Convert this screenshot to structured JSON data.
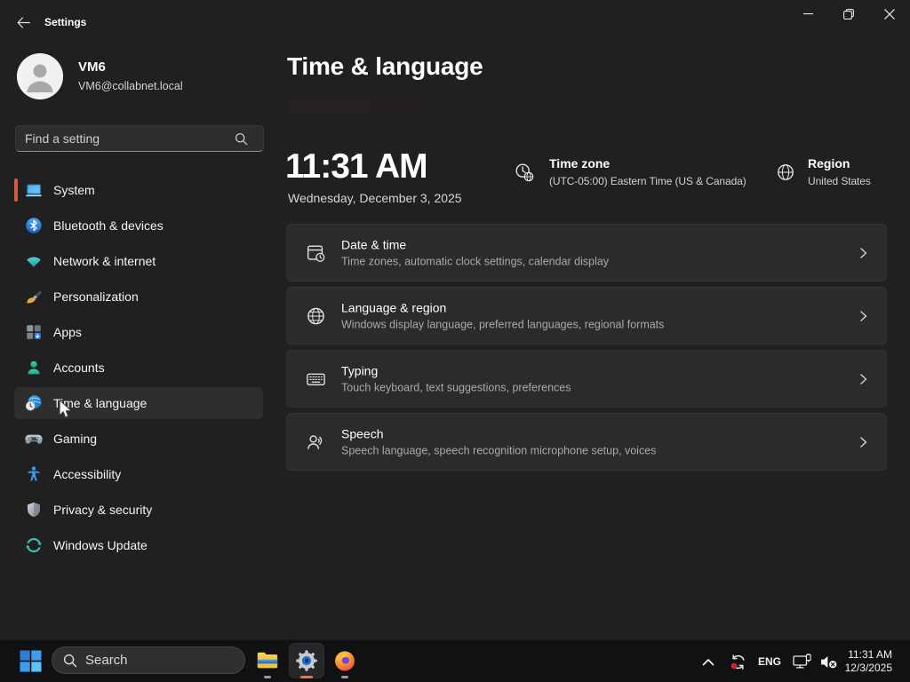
{
  "colors": {
    "accent": "#d25b41",
    "background": "#202020",
    "card": "#2b2b2b",
    "taskbar": "#101113"
  },
  "titlebar": {
    "app_title": "Settings",
    "back_icon": "back-arrow",
    "controls": [
      "minimize",
      "restore",
      "close"
    ]
  },
  "user": {
    "name": "VM6",
    "email": "VM6@collabnet.local"
  },
  "sidebar": {
    "search_placeholder": "Find a setting",
    "selected_item": "Time & language",
    "accent_pill_at": "System",
    "items": [
      {
        "label": "System",
        "icon": "system-icon"
      },
      {
        "label": "Bluetooth & devices",
        "icon": "bluetooth-icon"
      },
      {
        "label": "Network & internet",
        "icon": "network-icon"
      },
      {
        "label": "Personalization",
        "icon": "personalization-icon"
      },
      {
        "label": "Apps",
        "icon": "apps-icon"
      },
      {
        "label": "Accounts",
        "icon": "accounts-icon"
      },
      {
        "label": "Time & language",
        "icon": "time-language-icon"
      },
      {
        "label": "Gaming",
        "icon": "gaming-icon"
      },
      {
        "label": "Accessibility",
        "icon": "accessibility-icon"
      },
      {
        "label": "Privacy & security",
        "icon": "privacy-icon"
      },
      {
        "label": "Windows Update",
        "icon": "windows-update-icon"
      }
    ]
  },
  "page": {
    "title": "Time & language",
    "clock": {
      "time": "11:31 AM",
      "date": "Wednesday, December 3, 2025"
    },
    "timezone": {
      "label": "Time zone",
      "value": "(UTC-05:00) Eastern Time (US & Canada)"
    },
    "region": {
      "label": "Region",
      "value": "United States"
    },
    "cards": [
      {
        "title": "Date & time",
        "subtitle": "Time zones, automatic clock settings, calendar display",
        "icon": "date-time-icon"
      },
      {
        "title": "Language & region",
        "subtitle": "Windows display language, preferred languages, regional formats",
        "icon": "language-region-icon"
      },
      {
        "title": "Typing",
        "subtitle": "Touch keyboard, text suggestions, preferences",
        "icon": "typing-icon"
      },
      {
        "title": "Speech",
        "subtitle": "Speech language, speech recognition microphone setup, voices",
        "icon": "speech-icon"
      }
    ]
  },
  "taskbar": {
    "search_label": "Search",
    "apps": [
      {
        "name": "File Explorer",
        "state": "running"
      },
      {
        "name": "Settings",
        "state": "active"
      },
      {
        "name": "Firefox",
        "state": "running"
      }
    ],
    "tray": {
      "language": "ENG",
      "time": "11:31 AM",
      "date": "12/3/2025"
    }
  }
}
